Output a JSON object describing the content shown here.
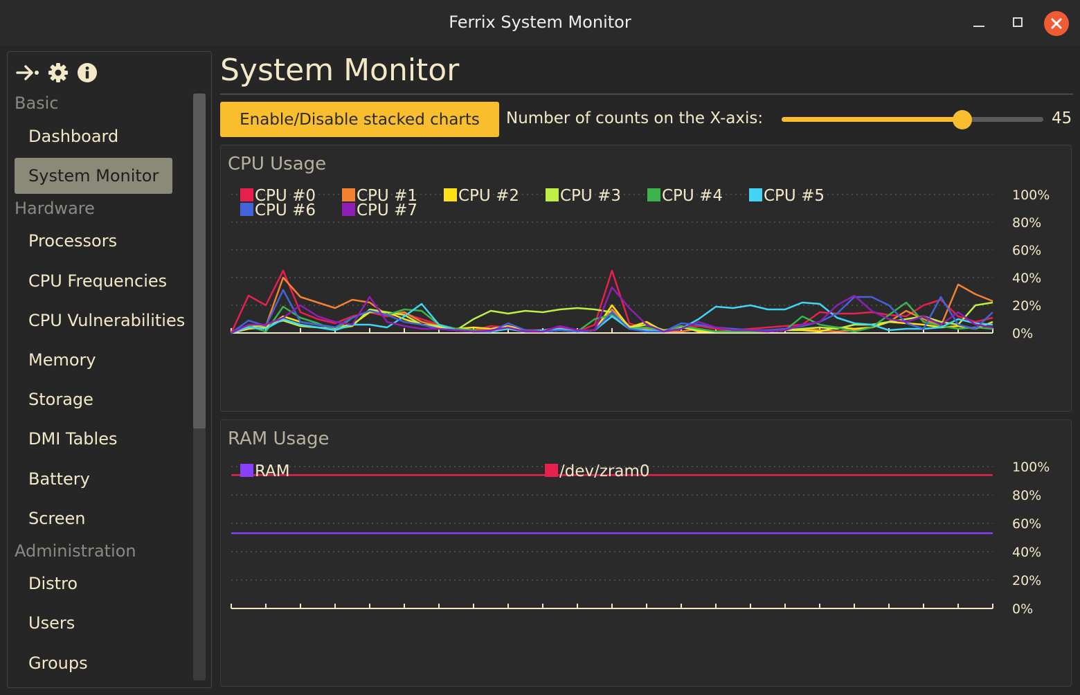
{
  "window": {
    "title": "Ferrix System Monitor"
  },
  "sidebar": {
    "icons": [
      "collapse-sidebar-icon",
      "gear-icon",
      "info-icon"
    ],
    "sections": [
      {
        "label": "Basic",
        "items": [
          {
            "label": "Dashboard"
          },
          {
            "label": "System Monitor",
            "active": true
          }
        ]
      },
      {
        "label": "Hardware",
        "items": [
          {
            "label": "Processors"
          },
          {
            "label": "CPU Frequencies"
          },
          {
            "label": "CPU Vulnerabilities"
          },
          {
            "label": "Memory"
          },
          {
            "label": "Storage"
          },
          {
            "label": "DMI Tables"
          },
          {
            "label": "Battery"
          },
          {
            "label": "Screen"
          }
        ]
      },
      {
        "label": "Administration",
        "items": [
          {
            "label": "Distro"
          },
          {
            "label": "Users"
          },
          {
            "label": "Groups"
          }
        ]
      }
    ]
  },
  "main": {
    "title": "System Monitor",
    "stack_button_label": "Enable/Disable stacked charts",
    "slider": {
      "label": "Number of counts on the X-axis:",
      "value": 45,
      "fraction": 0.69
    }
  },
  "colors": {
    "accent": "#f8be2d",
    "axis": "#f3e9c8"
  },
  "chart_data": [
    {
      "type": "line",
      "title": "CPU Usage",
      "x_count": 45,
      "y_ticks": [
        "100%",
        "80%",
        "60%",
        "40%",
        "20%",
        "0%"
      ],
      "ylim": [
        0,
        100
      ],
      "grid": true,
      "legend": "top-left",
      "series": [
        {
          "name": "CPU #0",
          "color": "#e8204e",
          "values": [
            0,
            27,
            20,
            45,
            15,
            10,
            7,
            12,
            15,
            12,
            14,
            10,
            6,
            3,
            2,
            5,
            4,
            2,
            2,
            4,
            1,
            6,
            45,
            7,
            3,
            1,
            4,
            5,
            3,
            2,
            3,
            4,
            5,
            6,
            15,
            14,
            14,
            15,
            13,
            12,
            20,
            24,
            12,
            8,
            11
          ]
        },
        {
          "name": "CPU #1",
          "color": "#f58231",
          "values": [
            0,
            5,
            5,
            40,
            26,
            22,
            18,
            24,
            22,
            13,
            15,
            8,
            5,
            3,
            2,
            2,
            3,
            2,
            1,
            2,
            1,
            2,
            17,
            5,
            3,
            1,
            1,
            3,
            1,
            1,
            1,
            1,
            2,
            3,
            2,
            1,
            2,
            4,
            8,
            16,
            10,
            5,
            35,
            28,
            23
          ]
        },
        {
          "name": "CPU #2",
          "color": "#ffe119",
          "values": [
            0,
            3,
            4,
            12,
            8,
            6,
            4,
            6,
            15,
            15,
            10,
            6,
            4,
            3,
            4,
            3,
            5,
            2,
            1,
            2,
            1,
            2,
            20,
            4,
            8,
            1,
            5,
            1,
            1,
            1,
            2,
            1,
            2,
            2,
            1,
            4,
            3,
            4,
            8,
            7,
            6,
            4,
            5,
            3,
            8
          ]
        },
        {
          "name": "CPU #3",
          "color": "#bfef45",
          "values": [
            0,
            4,
            6,
            9,
            5,
            4,
            3,
            5,
            17,
            15,
            13,
            6,
            5,
            2,
            10,
            16,
            14,
            16,
            15,
            17,
            18,
            17,
            15,
            4,
            6,
            2,
            4,
            2,
            1,
            1,
            1,
            1,
            2,
            3,
            4,
            3,
            6,
            6,
            8,
            10,
            12,
            8,
            6,
            20,
            22
          ]
        },
        {
          "name": "CPU #4",
          "color": "#3cb44b",
          "values": [
            0,
            5,
            1,
            19,
            11,
            7,
            2,
            11,
            16,
            13,
            17,
            16,
            6,
            3,
            2,
            1,
            3,
            1,
            1,
            2,
            1,
            10,
            13,
            3,
            4,
            1,
            5,
            3,
            1,
            1,
            1,
            1,
            2,
            12,
            6,
            4,
            1,
            4,
            13,
            22,
            8,
            5,
            3,
            4,
            3
          ]
        },
        {
          "name": "CPU #5",
          "color": "#42d4f4",
          "values": [
            0,
            4,
            3,
            10,
            6,
            4,
            2,
            6,
            6,
            4,
            12,
            21,
            6,
            2,
            1,
            1,
            3,
            1,
            2,
            3,
            1,
            2,
            12,
            3,
            2,
            1,
            3,
            10,
            19,
            18,
            20,
            17,
            17,
            22,
            21,
            11,
            7,
            6,
            2,
            3,
            3,
            4,
            10,
            7,
            6
          ]
        },
        {
          "name": "CPU #6",
          "color": "#4363d8",
          "values": [
            0,
            9,
            5,
            31,
            8,
            6,
            4,
            11,
            16,
            13,
            8,
            6,
            3,
            2,
            1,
            1,
            7,
            2,
            1,
            2,
            1,
            2,
            15,
            3,
            1,
            1,
            7,
            6,
            4,
            3,
            2,
            2,
            3,
            5,
            8,
            14,
            26,
            26,
            20,
            7,
            3,
            26,
            6,
            3,
            15
          ]
        },
        {
          "name": "CPU #7",
          "color": "#911eb4",
          "values": [
            0,
            6,
            6,
            11,
            20,
            12,
            8,
            6,
            26,
            8,
            5,
            3,
            3,
            2,
            1,
            2,
            4,
            1,
            1,
            5,
            2,
            2,
            33,
            18,
            6,
            1,
            3,
            8,
            4,
            2,
            2,
            1,
            2,
            6,
            8,
            20,
            27,
            16,
            10,
            8,
            12,
            6,
            15,
            6,
            4
          ]
        }
      ]
    },
    {
      "type": "line",
      "title": "RAM Usage",
      "x_count": 45,
      "y_ticks": [
        "100%",
        "80%",
        "60%",
        "40%",
        "20%",
        "0%"
      ],
      "ylim": [
        0,
        100
      ],
      "grid": true,
      "legend": "top",
      "series": [
        {
          "name": "RAM",
          "color": "#8a3ffc",
          "values": [
            53,
            53,
            53,
            53,
            53,
            53,
            53,
            53,
            53,
            53,
            53,
            53,
            53,
            53,
            53,
            53,
            53,
            53,
            53,
            53,
            53,
            53,
            53,
            53,
            53,
            53,
            53,
            53,
            53,
            53,
            53,
            53,
            53,
            53,
            53,
            53,
            53,
            53,
            53,
            53,
            53,
            53,
            53,
            53,
            53
          ]
        },
        {
          "name": "/dev/zram0",
          "color": "#e8204e",
          "values": [
            94,
            94,
            94,
            94,
            94,
            94,
            94,
            94,
            94,
            94,
            94,
            94,
            94,
            94,
            94,
            94,
            94,
            94,
            94,
            94,
            94,
            94,
            94,
            94,
            94,
            94,
            94,
            94,
            94,
            94,
            94,
            94,
            94,
            94,
            94,
            94,
            94,
            94,
            94,
            94,
            94,
            94,
            94,
            94,
            94
          ]
        }
      ]
    }
  ]
}
